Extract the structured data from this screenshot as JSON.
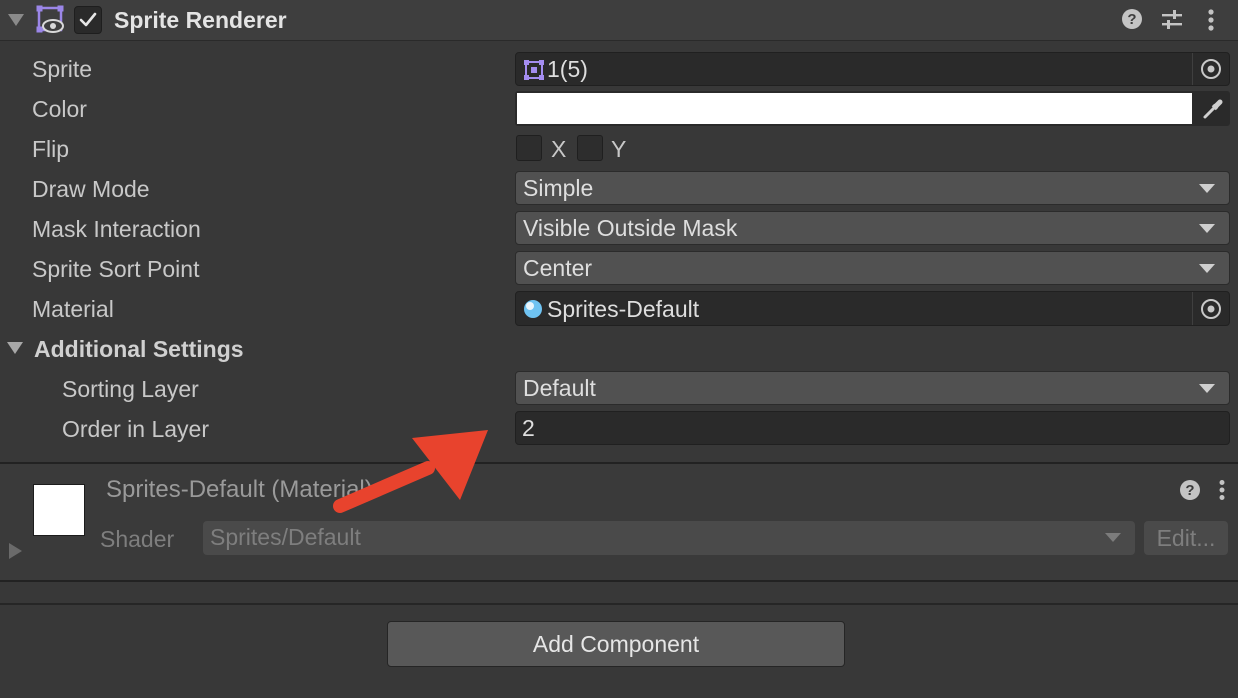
{
  "component": {
    "title": "Sprite Renderer",
    "enabled": true
  },
  "properties": {
    "sprite": {
      "label": "Sprite",
      "value": "1(5)"
    },
    "color": {
      "label": "Color",
      "value": "#ffffff"
    },
    "flip": {
      "label": "Flip",
      "x_label": "X",
      "y_label": "Y",
      "x_checked": false,
      "y_checked": false
    },
    "draw_mode": {
      "label": "Draw Mode",
      "value": "Simple"
    },
    "mask_interaction": {
      "label": "Mask Interaction",
      "value": "Visible Outside Mask"
    },
    "sprite_sort_point": {
      "label": "Sprite Sort Point",
      "value": "Center"
    },
    "material": {
      "label": "Material",
      "value": "Sprites-Default"
    }
  },
  "additional_settings": {
    "title": "Additional Settings",
    "sorting_layer": {
      "label": "Sorting Layer",
      "value": "Default"
    },
    "order_in_layer": {
      "label": "Order in Layer",
      "value": "2"
    }
  },
  "material_section": {
    "title": "Sprites-Default (Material)",
    "shader_label": "Shader",
    "shader_value": "Sprites/Default",
    "edit_label": "Edit..."
  },
  "footer": {
    "add_component_label": "Add Component"
  },
  "colors": {
    "annotation_arrow": "#e8432d",
    "sprite_icon": "#a48df0",
    "material_icon": "#6fc3f2"
  },
  "icons": {
    "header": [
      "sprite-renderer-icon",
      "help-icon",
      "preset-icon",
      "kebab-menu-icon"
    ],
    "fields": [
      "object-picker-icon",
      "eyedropper-icon"
    ]
  }
}
